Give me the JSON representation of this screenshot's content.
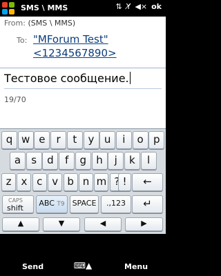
{
  "status": {
    "title": "SMS \\ MMS",
    "ok_label": "ok"
  },
  "header": {
    "from_label": "From:",
    "from_value": "(SMS \\ MMS)",
    "to_label": "To:",
    "to_line1": "\"MForum Test\"",
    "to_line2": "<1234567890>"
  },
  "message": {
    "text": "Тестовое сообщение.",
    "counter": "19/70"
  },
  "keyboard": {
    "row1": [
      "q",
      "w",
      "e",
      "r",
      "t",
      "y",
      "u",
      "i",
      "o",
      "p"
    ],
    "row2": [
      "a",
      "s",
      "d",
      "f",
      "g",
      "h",
      "j",
      "k",
      "l"
    ],
    "row3": [
      "z",
      "x",
      "c",
      "v",
      "b",
      "n",
      "m",
      "?",
      "!"
    ],
    "caps_label": "CAPS",
    "shift_label": "shift",
    "abc_label": "ABC",
    "t9_label": "T9",
    "space_label": "SPACE",
    "punct_label": ".,123"
  },
  "softkeys": {
    "left": "Send",
    "right": "Menu"
  },
  "icons": {
    "start": "windows-start-icon",
    "sync": "sync-icon",
    "signal": "no-signal-icon",
    "volume": "volume-mute-icon",
    "backspace": "backspace-icon",
    "enter": "enter-icon",
    "up": "arrow-up-icon",
    "down": "arrow-down-icon",
    "left": "arrow-left-icon",
    "right": "arrow-right-icon",
    "keyboard": "keyboard-icon"
  },
  "colors": {
    "accent": "#0a3d7d",
    "keyboard_bg": "#d6dbe0"
  }
}
